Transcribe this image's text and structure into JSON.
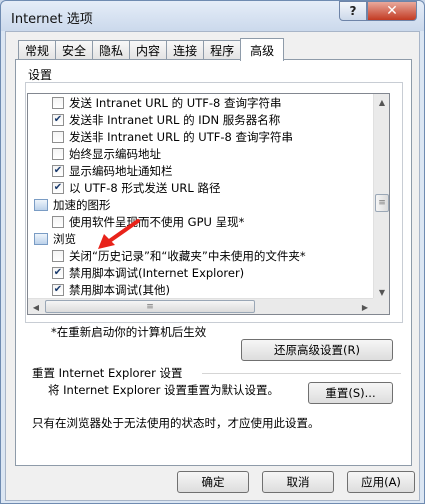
{
  "window": {
    "title": "Internet 选项",
    "help": "?",
    "close": "✕"
  },
  "tabs": [
    "常规",
    "安全",
    "隐私",
    "内容",
    "连接",
    "程序",
    "高级"
  ],
  "settings": {
    "label": "设置",
    "items": [
      {
        "type": "option",
        "checked": false,
        "text": "发送 Intranet URL 的 UTF-8 查询字符串"
      },
      {
        "type": "option",
        "checked": true,
        "text": "发送非 Intranet URL 的 IDN 服务器名称"
      },
      {
        "type": "option",
        "checked": false,
        "text": "发送非 Intranet URL 的 UTF-8 查询字符串"
      },
      {
        "type": "option",
        "checked": false,
        "text": "始终显示编码地址"
      },
      {
        "type": "option",
        "checked": true,
        "text": "显示编码地址通知栏"
      },
      {
        "type": "option",
        "checked": true,
        "text": "以 UTF-8 形式发送 URL 路径"
      },
      {
        "type": "category",
        "text": "加速的图形"
      },
      {
        "type": "option",
        "checked": false,
        "text": "使用软件呈现而不使用 GPU 呈现*"
      },
      {
        "type": "category",
        "text": "浏览"
      },
      {
        "type": "option",
        "checked": false,
        "text": "关闭“历史记录”和“收藏夹”中未使用的文件夹*"
      },
      {
        "type": "option",
        "checked": true,
        "text": "禁用脚本调试(Internet Explorer)"
      },
      {
        "type": "option",
        "checked": true,
        "text": "禁用脚本调试(其他)"
      }
    ],
    "restart_note": "*在重新启动你的计算机后生效",
    "restore_button": "还原高级设置(R)"
  },
  "reset": {
    "group_label": "重置 Internet Explorer 设置",
    "description": "将 Internet Explorer 设置重置为默认设置。",
    "button": "重置(S)...",
    "note": "只有在浏览器处于无法使用的状态时，才应使用此设置。"
  },
  "footer": {
    "ok": "确定",
    "cancel": "取消",
    "apply": "应用(A)"
  },
  "colors": {
    "arrow": "#e8231a",
    "frame": "#dbe6f3"
  },
  "icons": {
    "checkmark": "✔",
    "up": "▲",
    "down": "▼",
    "left": "◀",
    "right": "▶",
    "grip": "≡"
  }
}
